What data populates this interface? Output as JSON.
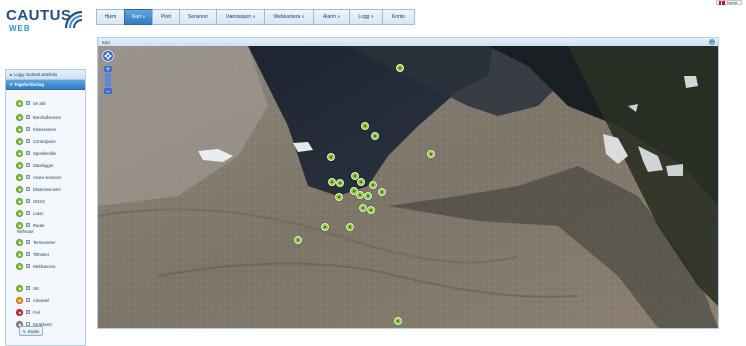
{
  "logo": {
    "name": "CAUTUS",
    "sub": "WEB"
  },
  "lang": {
    "label": "Norsk"
  },
  "nav": [
    {
      "label": "Hjem"
    },
    {
      "label": "Kart »"
    },
    {
      "label": "Plott"
    },
    {
      "label": "Sensorer"
    },
    {
      "label": "Værstasjon »"
    },
    {
      "label": "Webkamera »"
    },
    {
      "label": "Alarm »"
    },
    {
      "label": "Logg »"
    },
    {
      "label": "Konto"
    }
  ],
  "sidebar": {
    "login_header": "Logg: Norkart ørtefeitu",
    "legend_header": "Tegnforklaring",
    "items": [
      {
        "label": "Se alle",
        "color": "green"
      },
      {
        "label": "Borehullsensor",
        "color": "green"
      },
      {
        "label": "Klimasensor",
        "color": "green"
      },
      {
        "label": "Controlpoint",
        "color": "green"
      },
      {
        "label": "Sprekkmåler",
        "color": "green"
      },
      {
        "label": "Datalogger",
        "color": "green"
      },
      {
        "label": "Andre sensorer",
        "color": "green"
      },
      {
        "label": "Ekstensometer",
        "color": "green"
      },
      {
        "label": "GNSS",
        "color": "green"
      },
      {
        "label": "Laser",
        "color": "green"
      },
      {
        "label": "Radar",
        "color": "green"
      }
    ],
    "reflector_label": "Reflector",
    "items2": [
      {
        "label": "Termometer",
        "color": "green"
      },
      {
        "label": "Tiltmeter",
        "color": "green"
      },
      {
        "label": "Webkamera",
        "color": "green"
      }
    ],
    "status": [
      {
        "label": "OK",
        "color": "green"
      },
      {
        "label": "Advarsel",
        "color": "orange"
      },
      {
        "label": "Feil",
        "color": "red"
      },
      {
        "label": "Deaktivert",
        "color": "grey"
      }
    ],
    "endre_label": "Endre"
  },
  "map": {
    "title": "Kart",
    "marker_count": 26
  },
  "colors": {
    "accent": "#2f7cc2",
    "panel_border": "#b3cde3",
    "marker_ok": "#8cc63f"
  }
}
